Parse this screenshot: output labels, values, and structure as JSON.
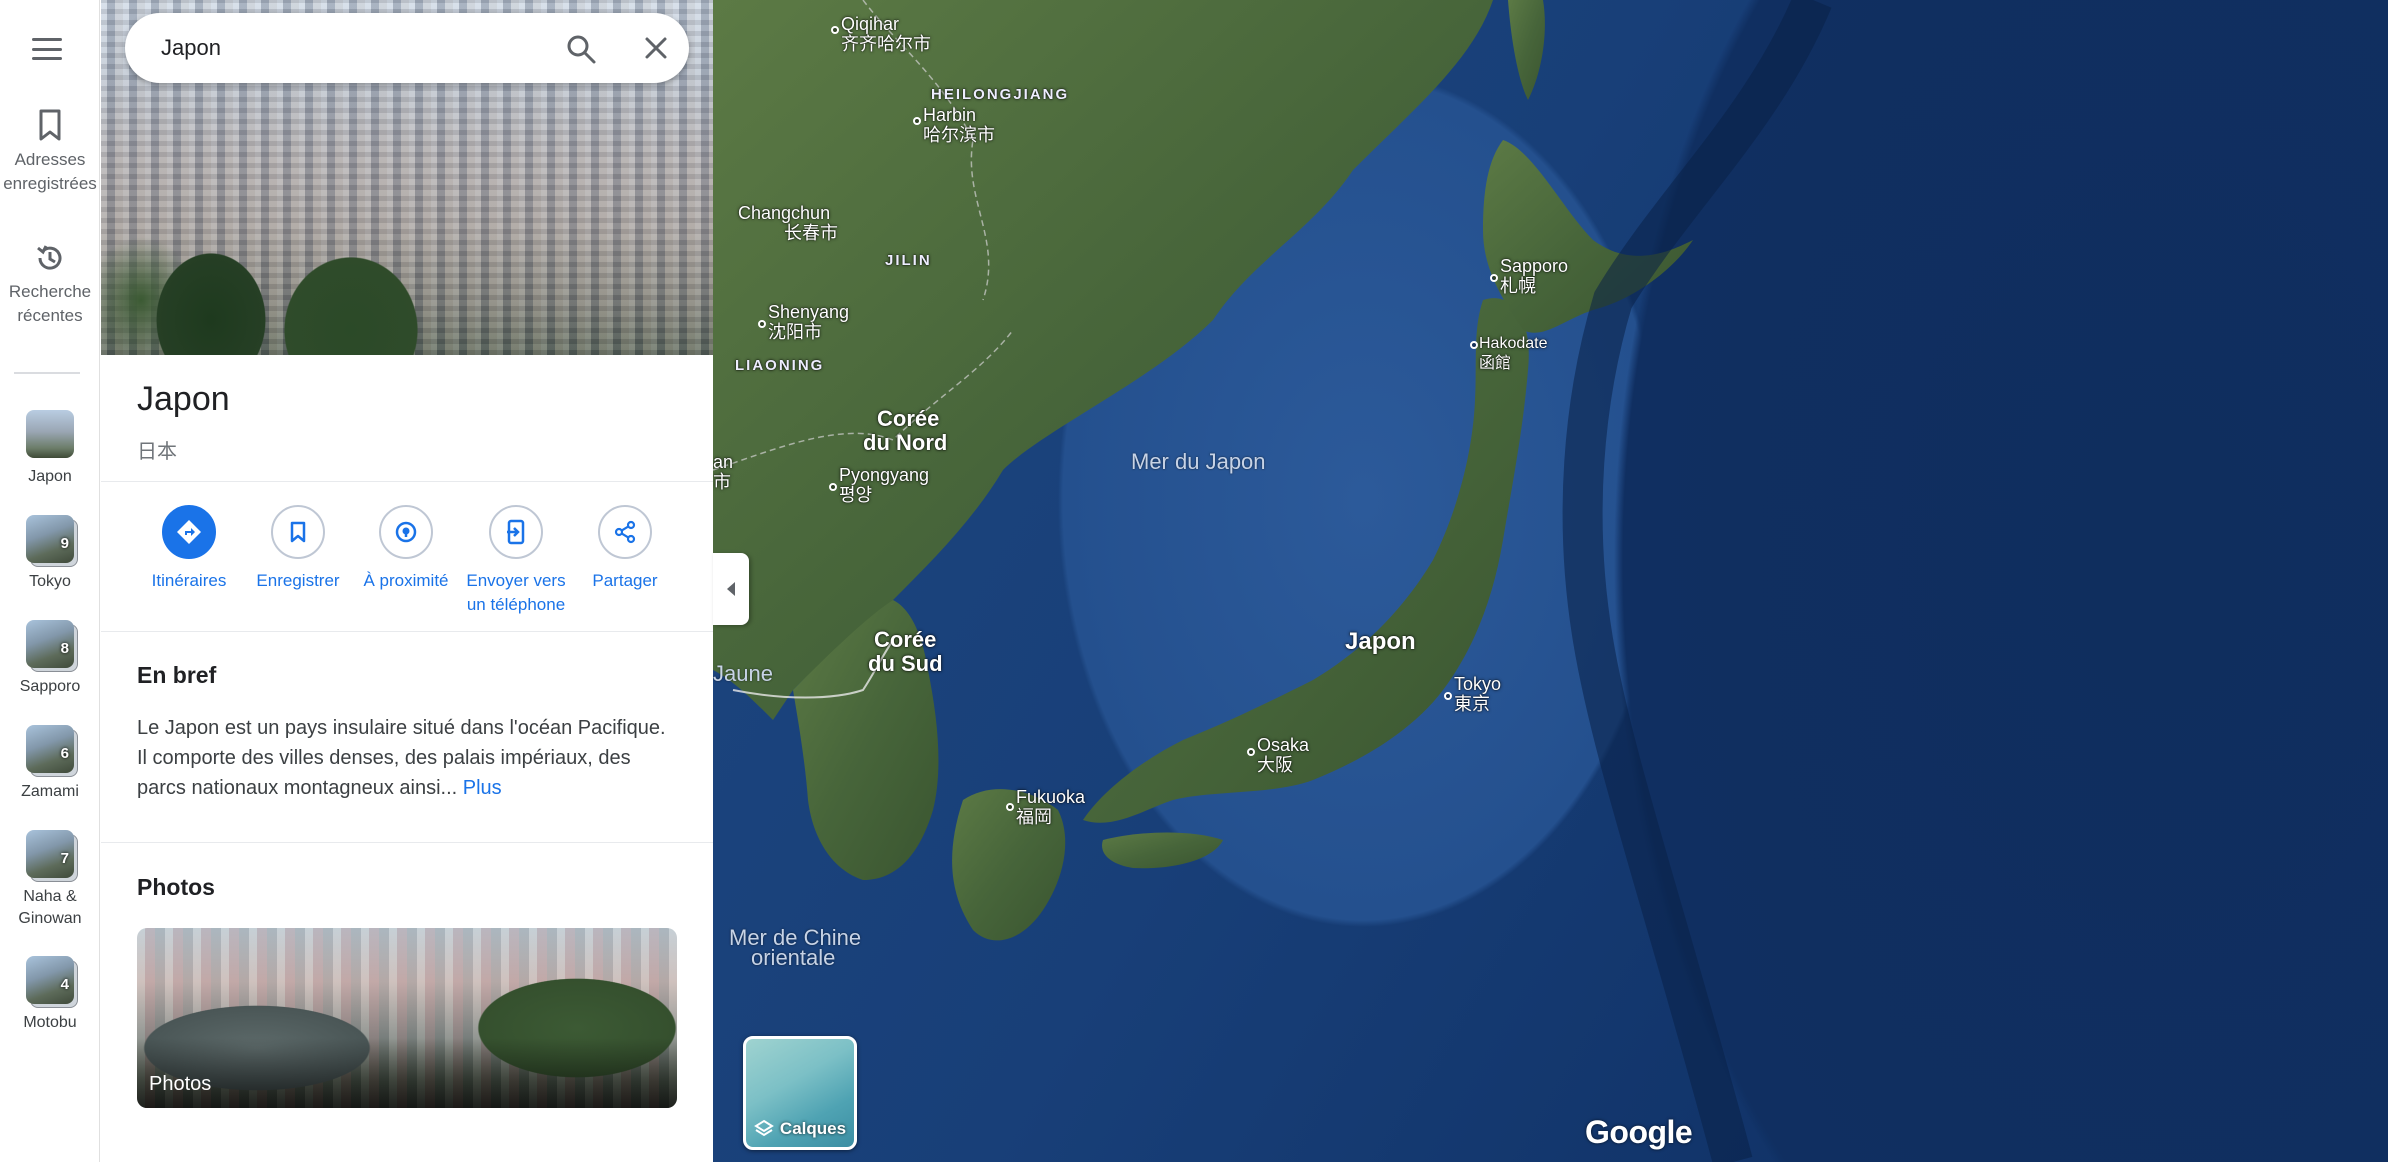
{
  "rail": {
    "saved": "Adresses enregistrées",
    "recent": "Recherche récentes",
    "places": [
      {
        "label": "Japon",
        "count": ""
      },
      {
        "label": "Tokyo",
        "count": "9"
      },
      {
        "label": "Sapporo",
        "count": "8"
      },
      {
        "label": "Zamami",
        "count": "6"
      },
      {
        "label": "Naha & Ginowan",
        "count": "7"
      },
      {
        "label": "Motobu",
        "count": "4"
      }
    ]
  },
  "search": {
    "value": "Japon"
  },
  "place": {
    "title": "Japon",
    "subtitle": "日本"
  },
  "actions": {
    "directions": "Itinéraires",
    "save": "Enregistrer",
    "nearby": "À proximité",
    "send": "Envoyer vers un téléphone",
    "share": "Partager"
  },
  "brief": {
    "title": "En bref",
    "text": "Le Japon est un pays insulaire situé dans l'océan Pacifique. Il comporte des villes denses, des palais impériaux, des parcs nationaux montagneux ainsi...",
    "more": "Plus"
  },
  "photos": {
    "title": "Photos",
    "card_label": "Photos"
  },
  "map": {
    "labels": {
      "qiqihar": "Qiqihar",
      "qiqihar_local": "齐齐哈尔市",
      "heilongjiang": "HEILONGJIANG",
      "harbin": "Harbin",
      "harbin_local": "哈尔滨市",
      "changchun": "Changchun",
      "changchun_local": "长春市",
      "jilin": "JILIN",
      "shenyang": "Shenyang",
      "shenyang_local": "沈阳市",
      "liaoning": "LIAONING",
      "north_korea_1": "Corée",
      "north_korea_2": "du Nord",
      "pyongyang": "Pyongyang",
      "pyongyang_local": "평양",
      "edge_top": "an",
      "edge_bottom": "市",
      "sea_japan": "Mer du Japon",
      "south_korea_1": "Corée",
      "south_korea_2": "du Sud",
      "yellow_sea": "Jaune",
      "japan": "Japon",
      "sapporo": "Sapporo",
      "sapporo_local": "札幌",
      "hakodate": "Hakodate",
      "hakodate_local": "函館",
      "tokyo": "Tokyo",
      "tokyo_local": "東京",
      "osaka": "Osaka",
      "osaka_local": "大阪",
      "fukuoka": "Fukuoka",
      "fukuoka_local": "福岡",
      "east_china_sea_1": "Mer de Chine",
      "east_china_sea_2": "orientale"
    },
    "layers_label": "Calques",
    "brand": "Google"
  },
  "colors": {
    "accent": "#1a73e8",
    "ocean_deep": "#0f2e5e",
    "land": "#4d6b3a"
  }
}
